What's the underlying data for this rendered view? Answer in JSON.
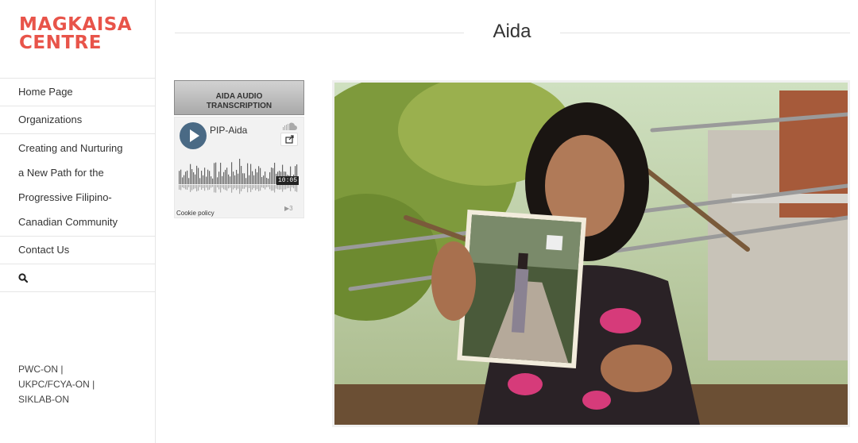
{
  "brand": {
    "line1": "MAGKAISA",
    "line2": "CENTRE",
    "color": "#e8544a"
  },
  "nav": {
    "home": "Home Page",
    "organizations": "Organizations",
    "creating": [
      "Creating and Nurturing",
      "a New Path for the",
      "Progressive Filipino-",
      "Canadian Community"
    ],
    "contact": "Contact Us",
    "search_icon": "search-icon"
  },
  "footer": {
    "lines": [
      "PWC-ON |",
      "UKPC/FCYA-ON |",
      "SIKLAB-ON"
    ]
  },
  "page": {
    "title": "Aida"
  },
  "audio": {
    "button_lines": [
      "AIDA AUDIO",
      "TRANSCRIPTION"
    ],
    "track_title": "PIP-Aida",
    "duration": "10:05",
    "cookie_policy": "Cookie policy",
    "plays": "▶3",
    "play_icon": "play-icon",
    "share_icon": "share-icon",
    "soundcloud_icon": "soundcloud-icon"
  },
  "photo": {
    "subject": "portrait-photo"
  }
}
